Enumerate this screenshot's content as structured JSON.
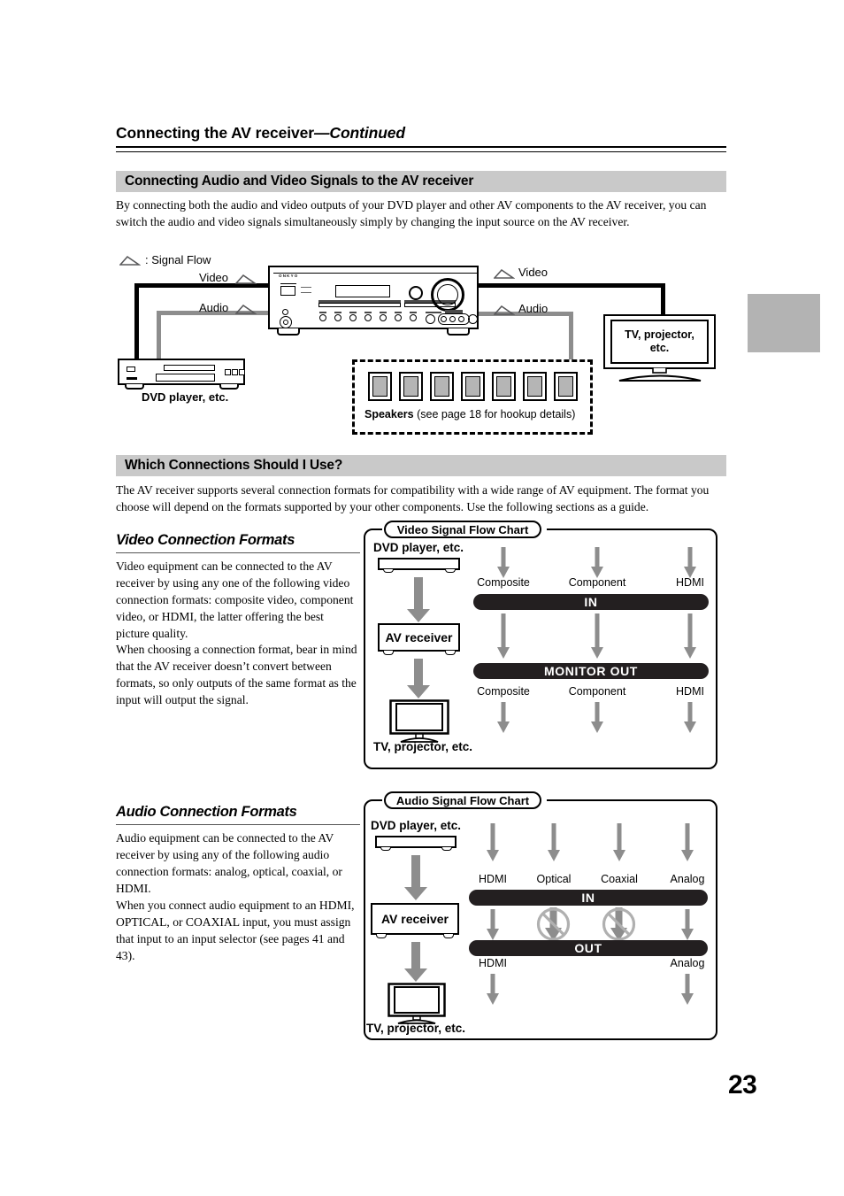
{
  "page": {
    "number": "23",
    "running_head_main": "Connecting the AV receiver",
    "running_head_cont": "—Continued"
  },
  "sections": [
    {
      "id": "av-signals",
      "title": "Connecting Audio and Video Signals to the AV receiver",
      "body": "By connecting both the audio and video outputs of your DVD player and other AV components to the AV receiver, you can switch the audio and video signals simultaneously simply by changing the input source on the AV receiver."
    },
    {
      "id": "which-connections",
      "title": "Which Connections Should I Use?",
      "body": "The AV receiver supports several connection formats for compatibility with a wide range of AV equipment. The format you choose will depend on the formats supported by your other components. Use the following sections as a guide."
    }
  ],
  "connection_diagram": {
    "legend": ": Signal Flow",
    "left_video_label": "Video",
    "left_audio_label": "Audio",
    "right_video_label": "Video",
    "right_audio_label": "Audio",
    "dvd_label": "DVD player, etc.",
    "tv_label_line1": "TV, projector,",
    "tv_label_line2": "etc.",
    "speakers_bold": "Speakers",
    "speakers_rest": " (see page 18 for hookup details)",
    "speaker_count": 7,
    "brand": "ONKYO"
  },
  "video_formats": {
    "heading": "Video Connection Formats",
    "paragraph1": "Video equipment can be connected to the AV receiver by using any one of the following video connection formats: composite video, component video, or HDMI, the latter offering the best picture quality.",
    "paragraph2": "When choosing a connection format, bear in mind that the AV receiver doesn’t convert between formats, so only outputs of the same format as the input will output the signal."
  },
  "audio_formats": {
    "heading": "Audio Connection Formats",
    "paragraph1": "Audio equipment can be connected to the AV receiver by using any of the following audio connection formats: analog, optical, coaxial, or HDMI.",
    "paragraph2": "When you connect audio equipment to an HDMI, OPTICAL, or COAXIAL input, you must assign that input to an input selector (see pages 41 and 43)."
  },
  "chart_data": [
    {
      "type": "diagram",
      "id": "video-signal-flow-chart",
      "title": "Video Signal Flow Chart",
      "source_device": "DVD player, etc.",
      "middle_device": "AV receiver",
      "sink_device": "TV, projector, etc.",
      "in_bus_label": "IN",
      "out_bus_label": "MONITOR OUT",
      "in_formats": [
        "Composite",
        "Component",
        "HDMI"
      ],
      "out_formats": [
        "Composite",
        "Component",
        "HDMI"
      ],
      "blocked_paths": []
    },
    {
      "type": "diagram",
      "id": "audio-signal-flow-chart",
      "title": "Audio Signal Flow Chart",
      "source_device": "DVD player, etc.",
      "middle_device": "AV receiver",
      "sink_device": "TV, projector, etc.",
      "in_bus_label": "IN",
      "out_bus_label": "OUT",
      "in_formats": [
        "HDMI",
        "Optical",
        "Coaxial",
        "Analog"
      ],
      "out_formats": [
        "HDMI",
        "",
        "",
        "Analog"
      ],
      "blocked_paths": [
        "Optical",
        "Coaxial"
      ]
    }
  ],
  "colors": {
    "bar_gray": "#c9c9c9",
    "bus_black": "#231f20",
    "arrow_gray": "#8d8d8d",
    "wire_gray": "#8d8d8d",
    "speaker_fill": "#b5b5b5",
    "thumb_tab": "#b3b3b3"
  }
}
